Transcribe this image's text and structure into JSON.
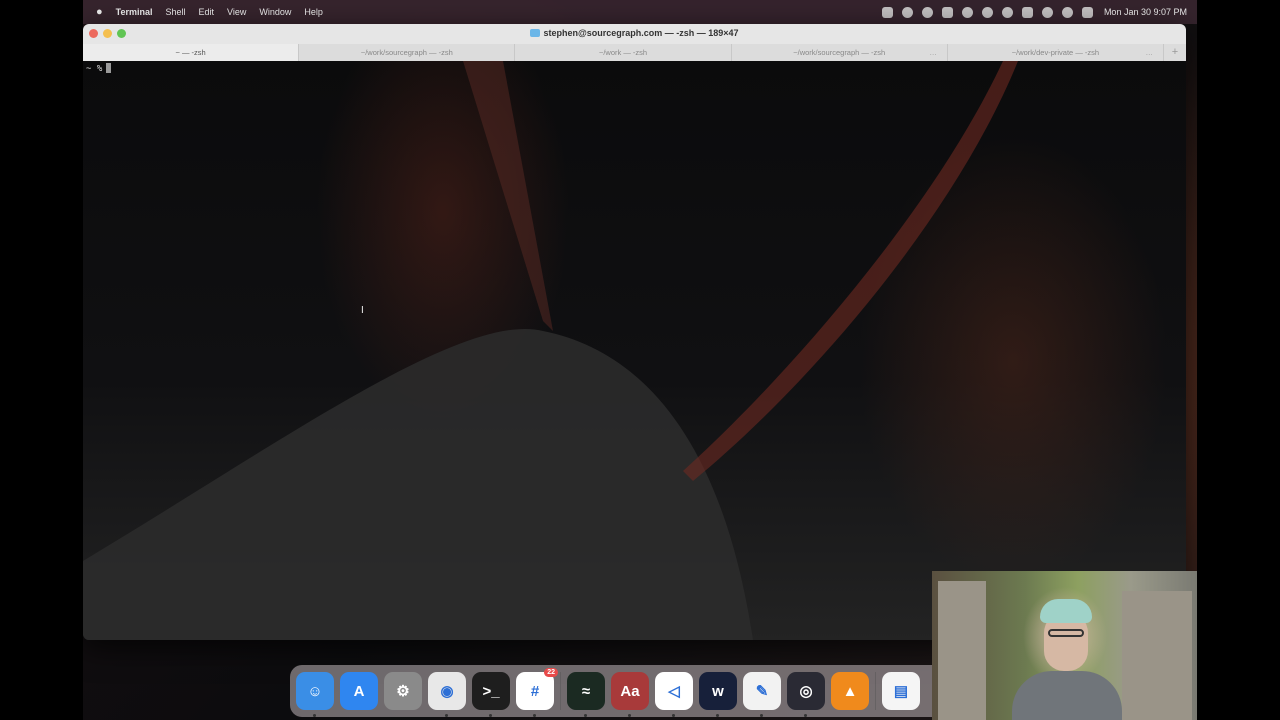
{
  "menubar": {
    "app_name": "Terminal",
    "items": [
      "Shell",
      "Edit",
      "View",
      "Window",
      "Help"
    ],
    "clock": "Mon Jan 30  9:07 PM"
  },
  "window": {
    "title": "stephen@sourcegraph.com — -zsh — 189×47",
    "tabs": [
      {
        "label": "~ — -zsh"
      },
      {
        "label": "~/work/sourcegraph — -zsh"
      },
      {
        "label": "~/work — -zsh"
      },
      {
        "label": "~/work/sourcegraph — -zsh"
      },
      {
        "label": "~/work/dev-private — -zsh"
      }
    ],
    "new_tab_label": "+"
  },
  "terminal": {
    "prompt": "~ %"
  },
  "dock": {
    "apps": [
      {
        "name": "Finder",
        "icon": "finder-icon",
        "color": "#3a8ee6",
        "glyph": "☺"
      },
      {
        "name": "App Store",
        "icon": "app-store-icon",
        "color": "#2f86f0",
        "glyph": "A"
      },
      {
        "name": "System Preferences",
        "icon": "settings-icon",
        "color": "#8a8a8a",
        "glyph": "⚙"
      },
      {
        "name": "Chrome",
        "icon": "chrome-icon",
        "color": "#e8e8e8",
        "glyph": "◉"
      },
      {
        "name": "Terminal",
        "icon": "terminal-icon",
        "color": "#1e1e1e",
        "glyph": ">_"
      },
      {
        "name": "Slack",
        "icon": "slack-icon",
        "color": "#ffffff",
        "glyph": "#",
        "badge": "22"
      },
      {
        "name": "Activity Monitor",
        "icon": "activity-monitor-icon",
        "color": "#1b2a22",
        "glyph": "≈"
      },
      {
        "name": "Dictionary",
        "icon": "dictionary-icon",
        "color": "#a83a3a",
        "glyph": "Aa"
      },
      {
        "name": "VS Code",
        "icon": "vscode-icon",
        "color": "#ffffff",
        "glyph": "◁"
      },
      {
        "name": "Webex",
        "icon": "webex-icon",
        "color": "#17203a",
        "glyph": "w"
      },
      {
        "name": "TextEdit",
        "icon": "textedit-icon",
        "color": "#f2f2f2",
        "glyph": "✎"
      },
      {
        "name": "OBS",
        "icon": "obs-icon",
        "color": "#2a2a34",
        "glyph": "◎"
      },
      {
        "name": "VLC",
        "icon": "vlc-icon",
        "color": "#f08a1c",
        "glyph": "▲"
      },
      {
        "name": "Document",
        "icon": "document-icon",
        "color": "#f5f5f5",
        "glyph": "▤"
      }
    ]
  }
}
